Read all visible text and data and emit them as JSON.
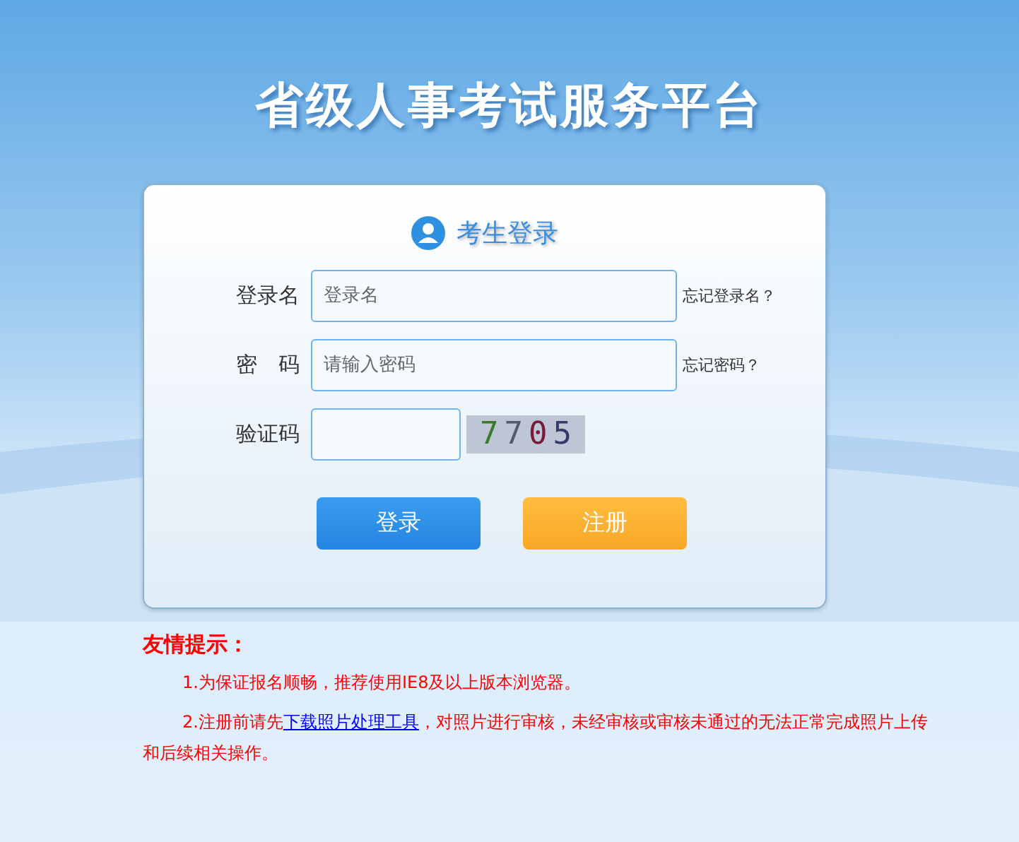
{
  "site_title": "省级人事考试服务平台",
  "login": {
    "heading": "考生登录",
    "fields": [
      {
        "label": "登录名",
        "placeholder": "登录名",
        "link": "忘记登录名？"
      },
      {
        "label": "密　码",
        "placeholder": "请输入密码",
        "link": "忘记密码？"
      }
    ],
    "captcha": {
      "label": "验证码",
      "code": "7705"
    },
    "buttons": [
      {
        "label": "登录",
        "kind": "primary"
      },
      {
        "label": "注册",
        "kind": "secondary"
      }
    ]
  },
  "tips": {
    "title": "友情提示：",
    "items": [
      {
        "before": "1.为保证报名顺畅，推荐使用IE8及以上版本浏览器。"
      },
      {
        "before": "2.注册前请先",
        "link": "下载照片处理工具",
        "after": "，对照片进行审核，未经审核或审核未通过的无法正常完成照片上传和后续相关操作。"
      }
    ]
  }
}
